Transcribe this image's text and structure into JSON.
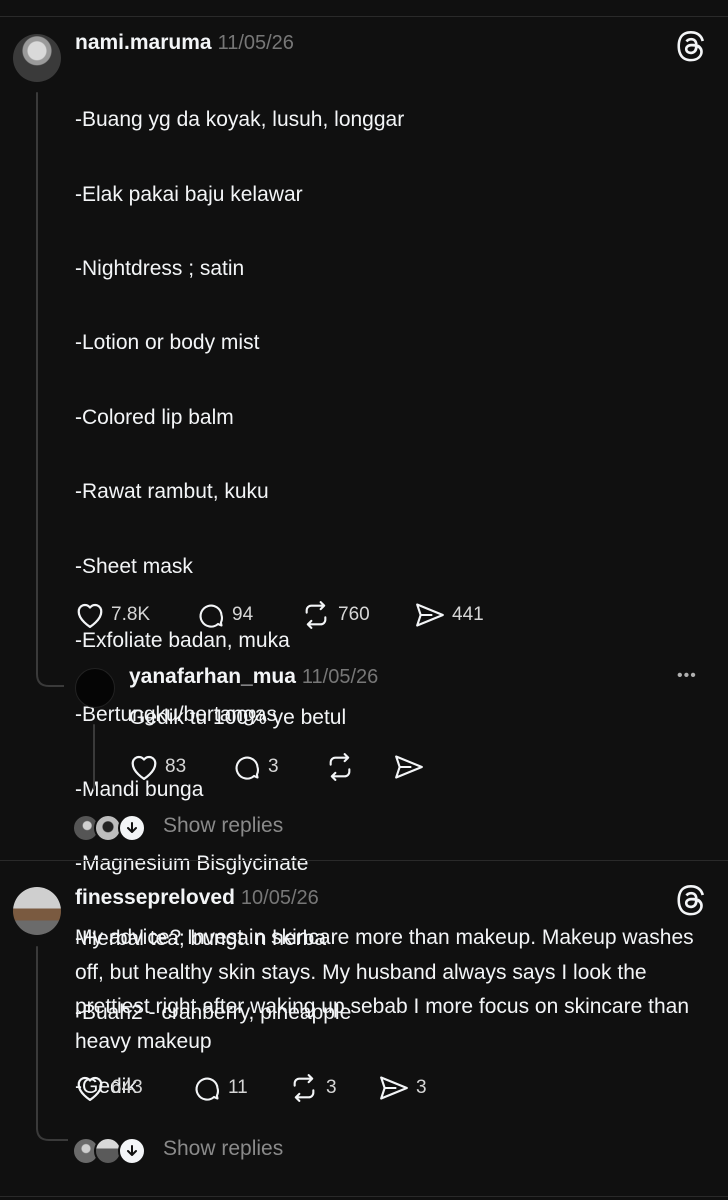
{
  "post1": {
    "username": "nami.maruma",
    "date": "11/05/26",
    "lines": [
      "-Buang yg da koyak, lusuh, longgar",
      "-Elak pakai baju kelawar",
      "-Nightdress ; satin",
      "-Lotion or body mist",
      "-Colored lip balm",
      "-Rawat rambut, kuku",
      "-Sheet mask",
      "-Exfoliate badan, muka",
      "-Bertungku/bertangas",
      "-Mandi bunga",
      "-Magnesium Bisglycinate",
      "-Herbal tea; bunga n herba",
      "-Buah2 - cranberry, pineapple",
      "-Gedik"
    ],
    "likes": "7.8K",
    "comments": "94",
    "reposts": "760",
    "shares": "441"
  },
  "reply1": {
    "username": "yanafarhan_mua",
    "date": "11/05/26",
    "text": "Gedik tu 100% ye betul",
    "likes": "83",
    "comments": "3",
    "more_label": "•••"
  },
  "show_replies_1": "Show replies",
  "post2": {
    "username": "finessepreloved",
    "date": "10/05/26",
    "text": "My advice? Invest in skincare more than makeup. Makeup washes off, but healthy skin stays. My husband always says I look the prettiest right after waking up sebab I more focus on skincare than heavy makeup",
    "likes": "643",
    "comments": "11",
    "reposts": "3",
    "shares": "3"
  },
  "show_replies_2": "Show replies",
  "icons": {
    "like": "heart-icon",
    "comment": "speech-bubble-icon",
    "repost": "repost-icon",
    "share": "send-icon",
    "logo": "threads-logo-icon",
    "more": "more-dots-icon"
  }
}
